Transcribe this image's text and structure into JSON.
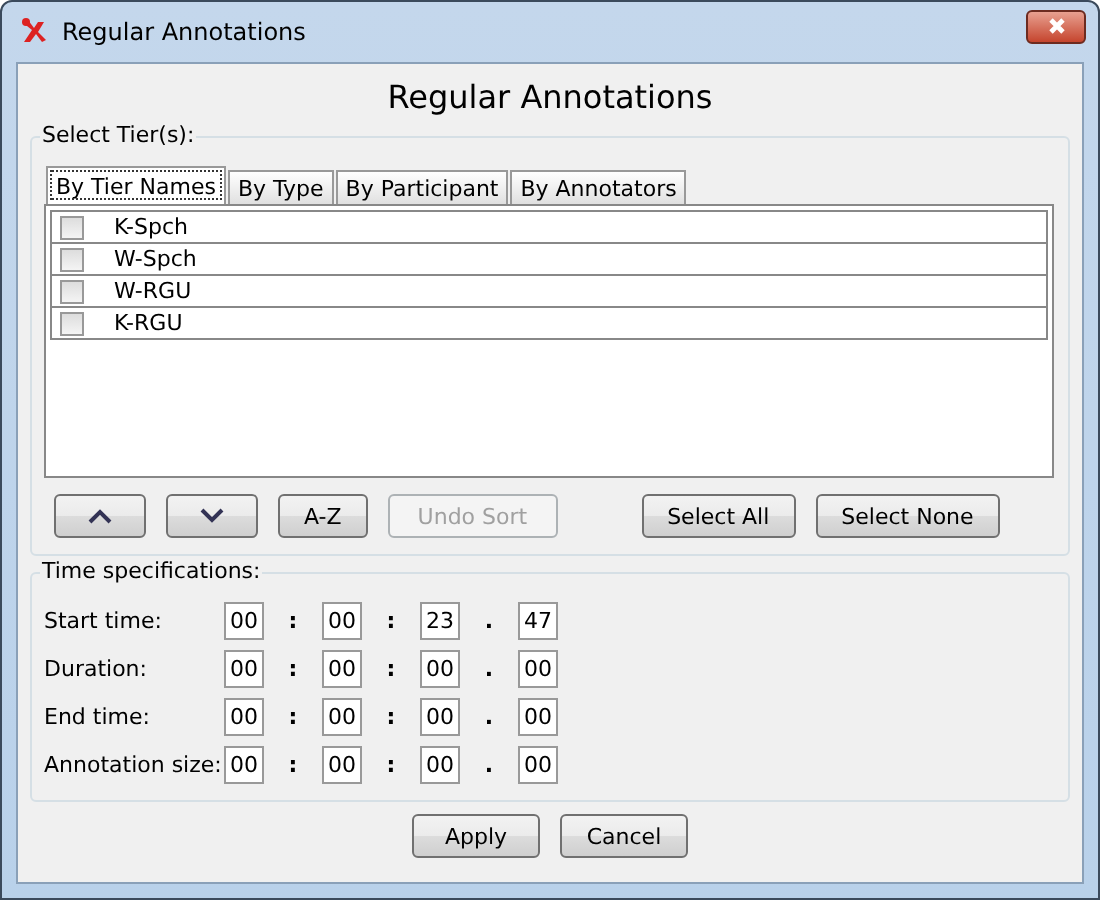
{
  "window": {
    "title": "Regular Annotations"
  },
  "heading": "Regular Annotations",
  "tier_group": {
    "label": "Select Tier(s):"
  },
  "tabs": [
    {
      "label": "By Tier Names",
      "selected": true
    },
    {
      "label": "By Type",
      "selected": false
    },
    {
      "label": "By Participant",
      "selected": false
    },
    {
      "label": "By Annotators",
      "selected": false
    }
  ],
  "tiers": [
    {
      "name": "K-Spch",
      "checked": false
    },
    {
      "name": "W-Spch",
      "checked": false
    },
    {
      "name": "W-RGU",
      "checked": false
    },
    {
      "name": "K-RGU",
      "checked": false
    }
  ],
  "list_buttons": [
    {
      "kind": "up"
    },
    {
      "kind": "down"
    },
    {
      "kind": "text",
      "label": "A-Z",
      "disabled": false
    },
    {
      "kind": "text",
      "label": "Undo Sort",
      "disabled": true
    },
    {
      "kind": "gap"
    },
    {
      "kind": "text",
      "label": "Select All",
      "disabled": false
    },
    {
      "kind": "text",
      "label": "Select None",
      "disabled": false
    }
  ],
  "time_group": {
    "label": "Time specifications:"
  },
  "time_rows": [
    {
      "label": "Start time:",
      "parts": [
        "00",
        "00",
        "23",
        "47"
      ]
    },
    {
      "label": "Duration:",
      "parts": [
        "00",
        "00",
        "00",
        "00"
      ]
    },
    {
      "label": "End time:",
      "parts": [
        "00",
        "00",
        "00",
        "00"
      ]
    },
    {
      "label": "Annotation size:",
      "parts": [
        "00",
        "00",
        "00",
        "00"
      ]
    }
  ],
  "separators": [
    ":",
    ":",
    "."
  ],
  "buttons": [
    "Apply",
    "Cancel"
  ]
}
